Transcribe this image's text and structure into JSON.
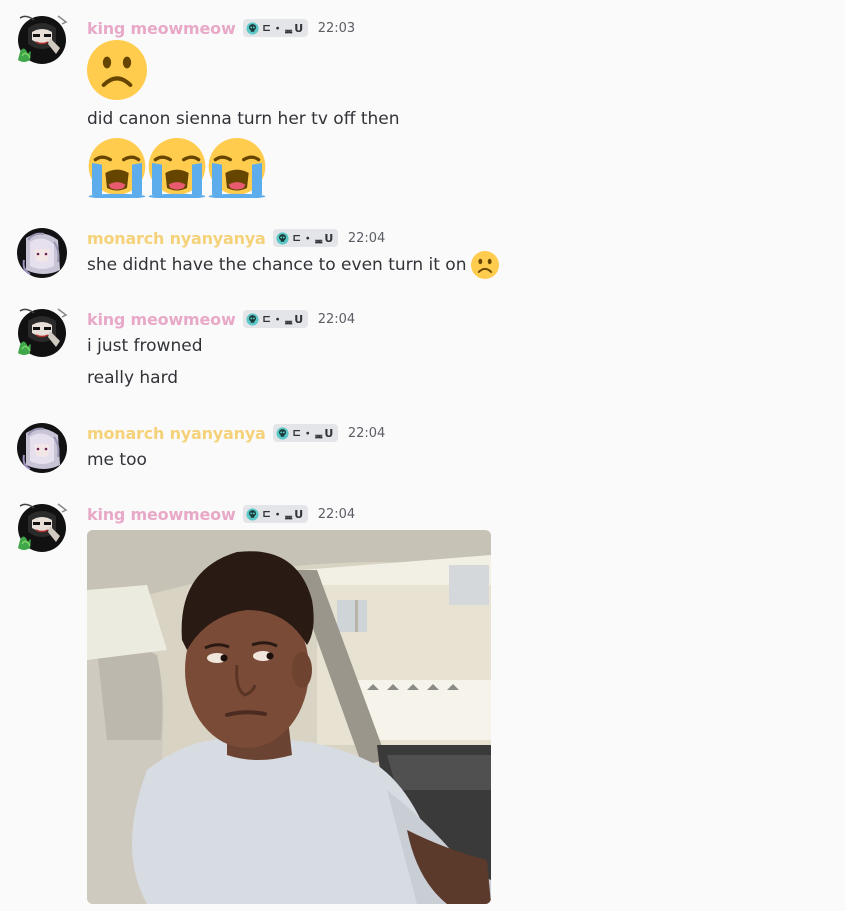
{
  "colors": {
    "king_name": "#e8a9c8",
    "monarch_name": "#f5d27a",
    "text": "#313338",
    "timestamp": "#5c5e66",
    "background": "#fafafa"
  },
  "messages": [
    {
      "author": "king meowmeow",
      "tag": "ㄷ・ᆴU",
      "time": "22:03",
      "lines": [
        "did canon sienna turn her tv off then"
      ],
      "emojis_big_top": [
        "frowning-face"
      ],
      "emojis_big_bottom": [
        "loudly-crying-face",
        "loudly-crying-face",
        "loudly-crying-face"
      ]
    },
    {
      "author": "monarch nyanyanya",
      "tag": "ㄷ・ᆴU",
      "time": "22:04",
      "lines": [
        "she didnt have the chance to even turn it on"
      ],
      "inline_emoji": "frowning-face"
    },
    {
      "author": "king meowmeow",
      "tag": "ㄷ・ᆴU",
      "time": "22:04",
      "lines": [
        "i just frowned",
        "really hard"
      ]
    },
    {
      "author": "monarch nyanyanya",
      "tag": "ㄷ・ᆴU",
      "time": "22:04",
      "lines": [
        "me too"
      ]
    },
    {
      "author": "king meowmeow",
      "tag": "ㄷ・ᆴU",
      "time": "22:04",
      "attachment": "gif-image"
    }
  ]
}
